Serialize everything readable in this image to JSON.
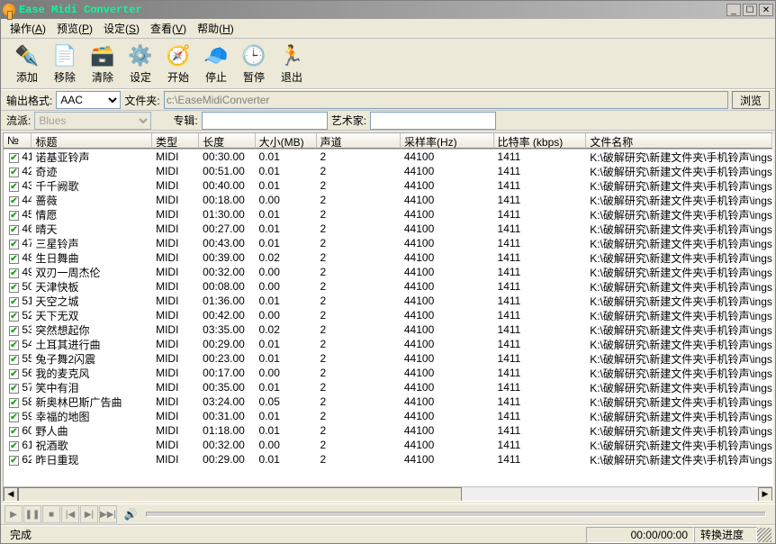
{
  "app": {
    "title": "Ease Midi Converter"
  },
  "winbtns": {
    "min": "_",
    "max": "☐",
    "close": "✕"
  },
  "menu": [
    {
      "label": "操作",
      "key": "A"
    },
    {
      "label": "预览",
      "key": "P"
    },
    {
      "label": "设定",
      "key": "S"
    },
    {
      "label": "查看",
      "key": "V"
    },
    {
      "label": "帮助",
      "key": "H"
    }
  ],
  "toolbar": [
    {
      "label": "添加",
      "emoji": "✒️"
    },
    {
      "label": "移除",
      "emoji": "📄"
    },
    {
      "label": "清除",
      "emoji": "🗃️"
    },
    {
      "label": "设定",
      "emoji": "⚙️"
    },
    {
      "label": "开始",
      "emoji": "🧭"
    },
    {
      "label": "停止",
      "emoji": "🧢"
    },
    {
      "label": "暂停",
      "emoji": "🕒"
    },
    {
      "label": "退出",
      "emoji": "🏃"
    }
  ],
  "opts": {
    "format_label": "输出格式:",
    "format_value": "AAC",
    "folder_label": "文件夹:",
    "folder_value": "c:\\EaseMidiConverter",
    "browse": "浏览",
    "genre_label": "流派:",
    "genre_value": "Blues",
    "album_label": "专辑:",
    "album_value": "",
    "artist_label": "艺术家:",
    "artist_value": ""
  },
  "columns": {
    "no": "№",
    "title": "标题",
    "type": "类型",
    "length": "长度",
    "size": "大小(MB)",
    "channels": "声道",
    "sample": "采样率(Hz)",
    "bitrate": "比特率 (kbps)",
    "filename": "文件名称"
  },
  "filepath": "K:\\破解研究\\新建文件夹\\手机铃声\\ingshen",
  "rows": [
    {
      "n": 41,
      "t": "诺基亚铃声",
      "ty": "MIDI",
      "len": "00:30.00",
      "sz": "0.01",
      "ch": 2,
      "sr": 44100,
      "br": 1411
    },
    {
      "n": 42,
      "t": "奇迹",
      "ty": "MIDI",
      "len": "00:51.00",
      "sz": "0.01",
      "ch": 2,
      "sr": 44100,
      "br": 1411
    },
    {
      "n": 43,
      "t": "千千阙歌",
      "ty": "MIDI",
      "len": "00:40.00",
      "sz": "0.01",
      "ch": 2,
      "sr": 44100,
      "br": 1411
    },
    {
      "n": 44,
      "t": "蔷薇",
      "ty": "MIDI",
      "len": "00:18.00",
      "sz": "0.00",
      "ch": 2,
      "sr": 44100,
      "br": 1411
    },
    {
      "n": 45,
      "t": "情愿",
      "ty": "MIDI",
      "len": "01:30.00",
      "sz": "0.01",
      "ch": 2,
      "sr": 44100,
      "br": 1411
    },
    {
      "n": 46,
      "t": "晴天",
      "ty": "MIDI",
      "len": "00:27.00",
      "sz": "0.01",
      "ch": 2,
      "sr": 44100,
      "br": 1411
    },
    {
      "n": 47,
      "t": "三星铃声",
      "ty": "MIDI",
      "len": "00:43.00",
      "sz": "0.01",
      "ch": 2,
      "sr": 44100,
      "br": 1411
    },
    {
      "n": 48,
      "t": "生日舞曲",
      "ty": "MIDI",
      "len": "00:39.00",
      "sz": "0.02",
      "ch": 2,
      "sr": 44100,
      "br": 1411
    },
    {
      "n": 49,
      "t": "双刃一周杰伦",
      "ty": "MIDI",
      "len": "00:32.00",
      "sz": "0.00",
      "ch": 2,
      "sr": 44100,
      "br": 1411
    },
    {
      "n": 50,
      "t": "天津快板",
      "ty": "MIDI",
      "len": "00:08.00",
      "sz": "0.00",
      "ch": 2,
      "sr": 44100,
      "br": 1411
    },
    {
      "n": 51,
      "t": "天空之城",
      "ty": "MIDI",
      "len": "01:36.00",
      "sz": "0.01",
      "ch": 2,
      "sr": 44100,
      "br": 1411
    },
    {
      "n": 52,
      "t": "天下无双",
      "ty": "MIDI",
      "len": "00:42.00",
      "sz": "0.00",
      "ch": 2,
      "sr": 44100,
      "br": 1411
    },
    {
      "n": 53,
      "t": "突然想起你",
      "ty": "MIDI",
      "len": "03:35.00",
      "sz": "0.02",
      "ch": 2,
      "sr": 44100,
      "br": 1411
    },
    {
      "n": 54,
      "t": "土耳其进行曲",
      "ty": "MIDI",
      "len": "00:29.00",
      "sz": "0.01",
      "ch": 2,
      "sr": 44100,
      "br": 1411
    },
    {
      "n": 55,
      "t": "兔子舞2闪震",
      "ty": "MIDI",
      "len": "00:23.00",
      "sz": "0.01",
      "ch": 2,
      "sr": 44100,
      "br": 1411
    },
    {
      "n": 56,
      "t": "我的麦克风",
      "ty": "MIDI",
      "len": "00:17.00",
      "sz": "0.00",
      "ch": 2,
      "sr": 44100,
      "br": 1411
    },
    {
      "n": 57,
      "t": "笑中有泪",
      "ty": "MIDI",
      "len": "00:35.00",
      "sz": "0.01",
      "ch": 2,
      "sr": 44100,
      "br": 1411
    },
    {
      "n": 58,
      "t": "新奥林巴斯广告曲",
      "ty": "MIDI",
      "len": "03:24.00",
      "sz": "0.05",
      "ch": 2,
      "sr": 44100,
      "br": 1411
    },
    {
      "n": 59,
      "t": "幸福的地图",
      "ty": "MIDI",
      "len": "00:31.00",
      "sz": "0.01",
      "ch": 2,
      "sr": 44100,
      "br": 1411
    },
    {
      "n": 60,
      "t": "野人曲",
      "ty": "MIDI",
      "len": "01:18.00",
      "sz": "0.01",
      "ch": 2,
      "sr": 44100,
      "br": 1411
    },
    {
      "n": 61,
      "t": "祝酒歌",
      "ty": "MIDI",
      "len": "00:32.00",
      "sz": "0.00",
      "ch": 2,
      "sr": 44100,
      "br": 1411
    },
    {
      "n": 62,
      "t": "昨日重现",
      "ty": "MIDI",
      "len": "00:29.00",
      "sz": "0.01",
      "ch": 2,
      "sr": 44100,
      "br": 1411
    }
  ],
  "player": {
    "play": "▶",
    "pause": "❚❚",
    "stop": "■",
    "prev": "|◀",
    "next": "▶|",
    "last": "▶▶|"
  },
  "status": {
    "ready": "完成",
    "time": "00:00/00:00",
    "progress": "转换进度"
  }
}
